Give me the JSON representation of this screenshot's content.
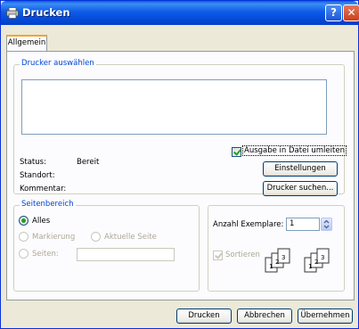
{
  "window": {
    "title": "Drucken",
    "help_glyph": "?",
    "close_glyph": "✕",
    "icon": "printer-icon"
  },
  "tabs": [
    {
      "label": "Allgemein",
      "selected": true
    }
  ],
  "printer_group": {
    "legend": "Drucker auswählen",
    "status_label": "Status:",
    "status_value": "Bereit",
    "location_label": "Standort:",
    "comment_label": "Kommentar:",
    "print_to_file_label": "Ausgabe in Datei umleiten",
    "print_to_file_checked": true,
    "settings_button": "Einstellungen",
    "find_printer_button": "Drucker suchen..."
  },
  "page_range": {
    "legend": "Seitenbereich",
    "options": {
      "all": "Alles",
      "selection": "Markierung",
      "current_page": "Aktuelle Seite",
      "pages": "Seiten:"
    },
    "selected": "all",
    "pages_value": ""
  },
  "copies": {
    "label": "Anzahl Exemplare:",
    "value": "1",
    "collate_label": "Sortieren",
    "collate_checked": true,
    "collate_disabled": true,
    "collate_pages": [
      "1",
      "2",
      "3",
      "1",
      "2",
      "3"
    ]
  },
  "footer": {
    "print_button": "Drucken",
    "cancel_button": "Abbrechen",
    "apply_button": "Übernehmen"
  },
  "colors": {
    "titlebar": "#0548d6",
    "group_legend": "#0046d5",
    "dialog_bg": "#ece9d8",
    "checkmark": "#21a121"
  }
}
